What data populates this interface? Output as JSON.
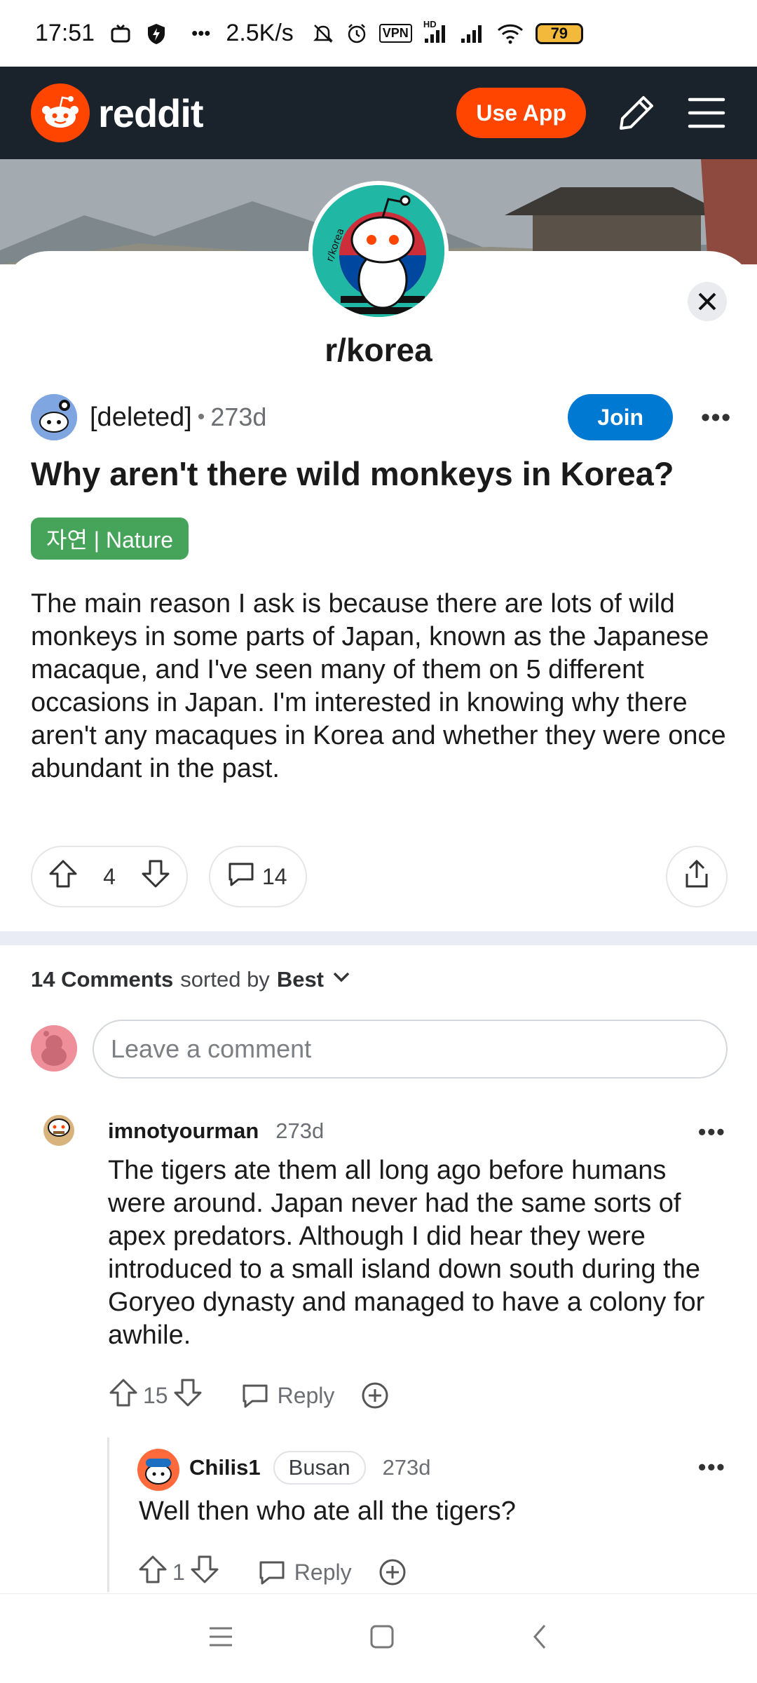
{
  "status_bar": {
    "time": "17:51",
    "dots": "•••",
    "net_speed": "2.5K/s",
    "vpn": "VPN",
    "hd": "HD",
    "battery": "79"
  },
  "header": {
    "logo_text": "reddit",
    "use_app_label": "Use App"
  },
  "subreddit": {
    "name": "r/korea",
    "avatar_text": "r/korea"
  },
  "post": {
    "author": "[deleted]",
    "dot": "•",
    "age": "273d",
    "join_label": "Join",
    "more": "•••",
    "title": "Why aren't there wild monkeys in Korea?",
    "flair": "자연 | Nature",
    "body": "The main reason I ask is because there are lots of wild monkeys in some parts of Japan, known as the Japanese macaque, and I've seen many of them on 5 different occasions in Japan. I'm interested in knowing why there aren't any macaques in Korea and whether they were once abundant in the past.",
    "votes": "4",
    "comment_count": "14"
  },
  "comments_section": {
    "count_label": "14 Comments",
    "sorted_by": "sorted by",
    "sort_value": "Best",
    "input_placeholder": "Leave a comment"
  },
  "comments": [
    {
      "user": "imnotyourman",
      "age": "273d",
      "more": "•••",
      "body": "The tigers ate them all long ago before humans were around. Japan never had the same sorts of apex predators. Although I did hear they were introduced to a small island down south during the Goryeo dynasty and managed to have a colony for awhile.",
      "votes": "15",
      "reply_label": "Reply"
    },
    {
      "user": "Chilis1",
      "flair": "Busan",
      "age": "273d",
      "more": "•••",
      "body": "Well then who ate all the tigers?",
      "votes": "1",
      "reply_label": "Reply"
    }
  ],
  "colors": {
    "reddit_orange": "#ff4500",
    "header_bg": "#1a222b",
    "join_blue": "#0079d3",
    "flair_green": "#46a35a"
  },
  "icons": {
    "upvote": "arrow-up-icon",
    "downvote": "arrow-down-icon",
    "comment": "speech-bubble-icon",
    "share": "share-icon",
    "award": "award-icon",
    "edit": "pencil-icon",
    "menu": "hamburger-icon",
    "close": "close-icon"
  }
}
